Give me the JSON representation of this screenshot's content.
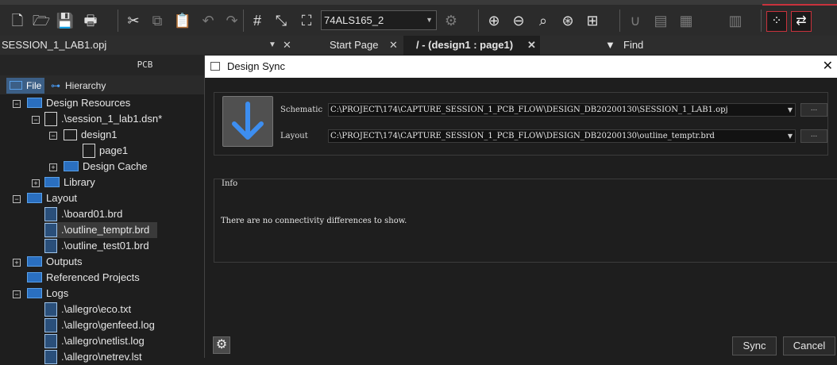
{
  "toolbar": {
    "part_combo_value": "74ALS165_2",
    "icons": [
      "new-file-icon",
      "open-folder-icon",
      "save-icon",
      "print-icon",
      "cut-icon",
      "copy-icon",
      "paste-icon",
      "undo-icon",
      "redo-icon",
      "select-grid-icon",
      "move-icon",
      "fit-icon",
      "component-icon",
      "zoom-in-icon",
      "zoom-out-icon",
      "zoom-area-icon",
      "zoom-all-icon",
      "align-icon",
      "magnet-icon",
      "pcb-icon",
      "place-icon",
      "table-icon",
      "net-highlight-icon",
      "net-swap-icon"
    ]
  },
  "tabs": {
    "session_file": "SESSION_1_LAB1.opj",
    "start_page": "Start Page",
    "design_page": "/ - (design1 : page1)",
    "find": "Find"
  },
  "panel": {
    "title": "PCB",
    "tab_file": "File",
    "tab_hierarchy": "Hierarchy"
  },
  "tree": [
    {
      "label": "Design Resources",
      "kind": "folder",
      "expander": "−"
    },
    {
      "label": ".\\session_1_lab1.dsn*",
      "kind": "file",
      "expander": "−"
    },
    {
      "label": "design1",
      "kind": "file",
      "expander": "−"
    },
    {
      "label": "page1",
      "kind": "file",
      "expander": ""
    },
    {
      "label": "Design Cache",
      "kind": "folder",
      "expander": "+"
    },
    {
      "label": "Library",
      "kind": "folder",
      "expander": "+"
    },
    {
      "label": "Layout",
      "kind": "folder",
      "expander": "−"
    },
    {
      "label": ".\\board01.brd",
      "kind": "brd",
      "expander": ""
    },
    {
      "label": ".\\outline_temptr.brd",
      "kind": "brd",
      "expander": ""
    },
    {
      "label": ".\\outline_test01.brd",
      "kind": "brd",
      "expander": ""
    },
    {
      "label": "Outputs",
      "kind": "folder",
      "expander": "+"
    },
    {
      "label": "Referenced Projects",
      "kind": "folder",
      "expander": ""
    },
    {
      "label": "Logs",
      "kind": "folder",
      "expander": "−"
    },
    {
      "label": ".\\allegro\\eco.txt",
      "kind": "brd",
      "expander": ""
    },
    {
      "label": ".\\allegro\\genfeed.log",
      "kind": "brd",
      "expander": ""
    },
    {
      "label": ".\\allegro\\netlist.log",
      "kind": "brd",
      "expander": ""
    },
    {
      "label": ".\\allegro\\netrev.lst",
      "kind": "brd",
      "expander": ""
    }
  ],
  "dialog": {
    "title": "Design Sync",
    "schematic_label": "Schematic",
    "schematic_path": "C:\\PROJECT\\174\\CAPTURE_SESSION_1_PCB_FLOW\\DESIGN_DB20200130\\SESSION_1_LAB1.opj",
    "layout_label": "Layout",
    "layout_path": "C:\\PROJECT\\174\\CAPTURE_SESSION_1_PCB_FLOW\\DESIGN_DB20200130\\outline_temptr.brd",
    "browse_label": "...",
    "info_title": "Info",
    "info_message": "There are no connectivity differences to show.",
    "sync_label": "Sync",
    "cancel_label": "Cancel"
  }
}
